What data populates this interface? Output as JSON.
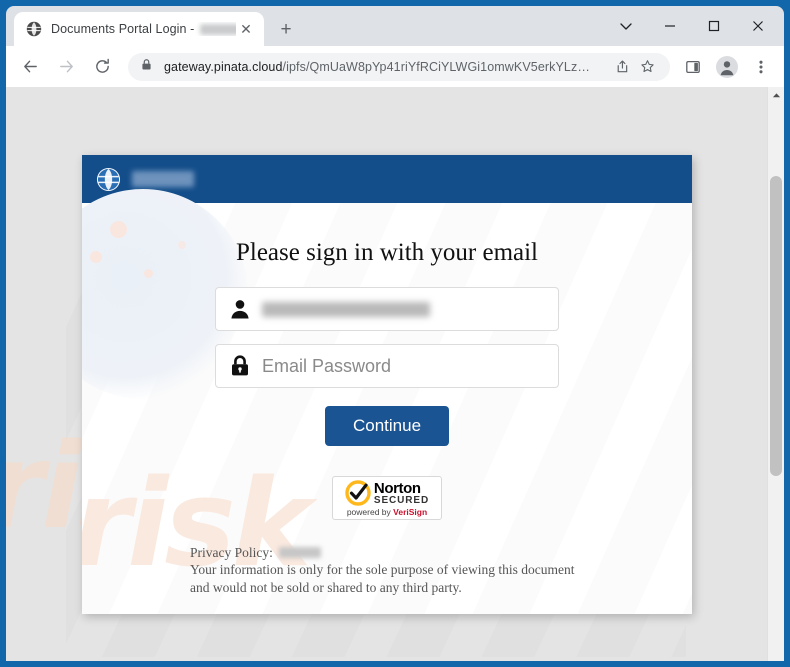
{
  "browser": {
    "tab": {
      "title": "Documents Portal Login - ",
      "title_redacted": true,
      "favicon": "globe-icon",
      "close_label": "✕"
    },
    "new_tab_label": "+",
    "window_controls": {
      "tab_search": "⌄",
      "minimize": "—",
      "maximize": "□",
      "close": "✕"
    },
    "toolbar": {
      "back": "←",
      "forward": "→",
      "reload": "⟳",
      "lock_icon": "padlock-icon",
      "url_host": "gateway.pinata.cloud",
      "url_path": "/ipfs/QmUaW8pYp41riYfRCiYLWGi1omwKV5erkYLz…",
      "share_icon": "share-icon",
      "bookmark_icon": "star-icon",
      "side_panel_icon": "side-panel-icon",
      "profile_icon": "profile-avatar-icon",
      "menu_icon": "three-dot-menu-icon"
    }
  },
  "page": {
    "background_color": "#e4e4e4",
    "watermark_text": "risk",
    "card_watermark_text": "risk",
    "header": {
      "background_color": "#144e8a",
      "logo_icon": "globe-icon",
      "brand_name_redacted": true
    },
    "heading": "Please sign in with your email",
    "email_field": {
      "icon": "user-icon",
      "value_redacted": true,
      "value": ""
    },
    "password_field": {
      "icon": "lock-icon",
      "placeholder": "Email Password",
      "value": ""
    },
    "continue_button": {
      "label": "Continue",
      "color": "#1a5493"
    },
    "norton_badge": {
      "name": "Norton",
      "secured": "SECURED",
      "powered_prefix": "powered by ",
      "powered_brand": "VeriSign",
      "check_color": "#ffb81c"
    },
    "privacy": {
      "policy_label": "Privacy Policy:",
      "policy_value_redacted": true,
      "line1": "Your information is only for the sole purpose of viewing this document",
      "line2": "and would not be sold or shared to any third party."
    }
  }
}
